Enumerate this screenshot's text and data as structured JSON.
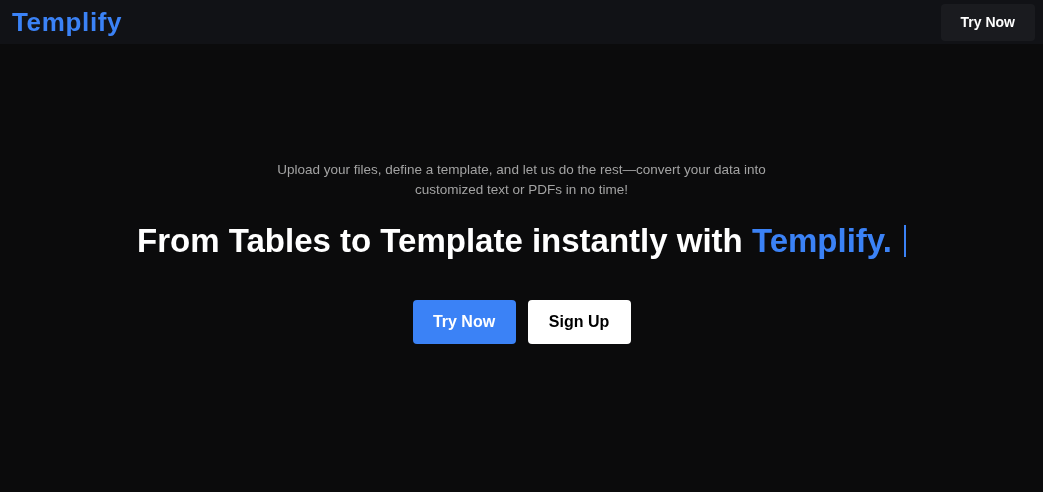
{
  "header": {
    "logo": "Templify",
    "button": "Try Now"
  },
  "hero": {
    "tagline": "Upload your files, define a template, and let us do the rest—convert your data into customized text or PDFs in no time!",
    "headline": "From Tables to Template instantly with",
    "highlight": "Templify.",
    "buttons": [
      {
        "label": "Try Now",
        "kind": "primary"
      },
      {
        "label": "Sign Up",
        "kind": "secondary"
      }
    ]
  }
}
